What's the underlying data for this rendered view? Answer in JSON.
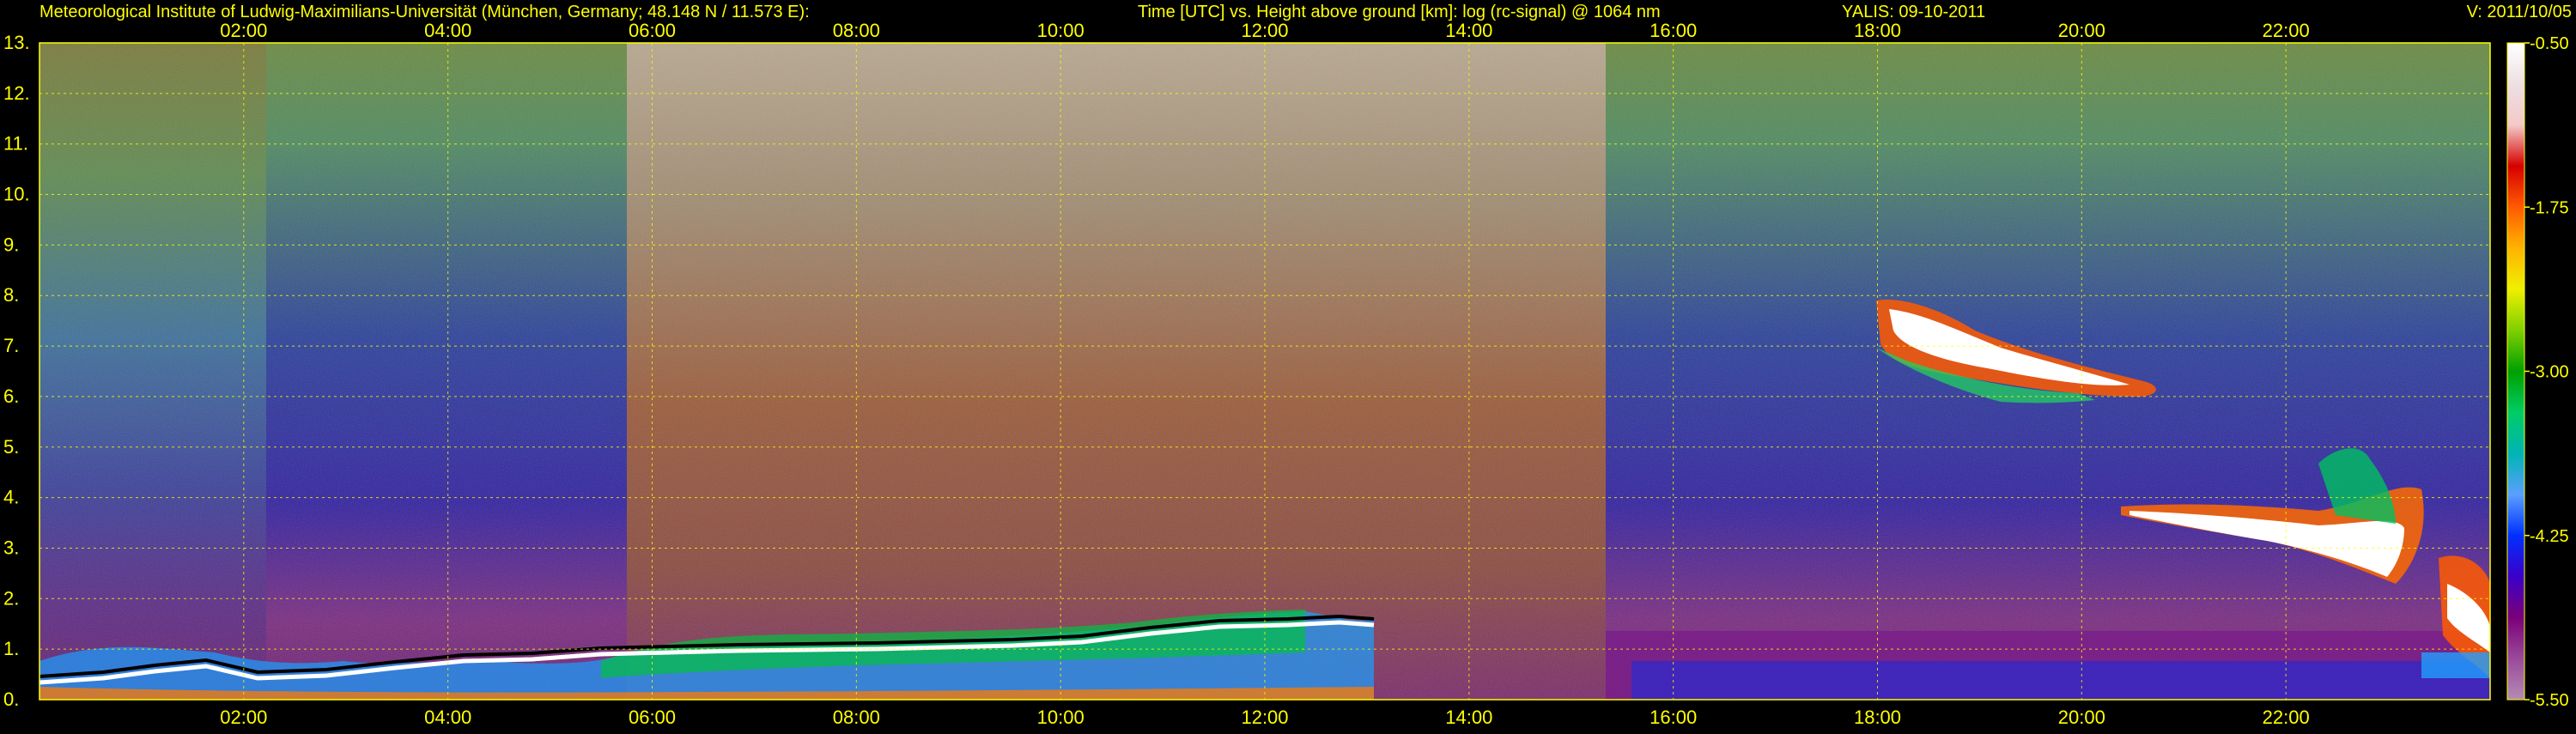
{
  "header": {
    "institute": "Meteorological Institute of Ludwig-Maximilians-Universität (München, Germany; 48.148 N / 11.573 E):",
    "plot_title": "Time [UTC] vs. Height above ground [km]: log (rc-signal) @ 1064 nm",
    "station_date": "YALIS: 09-10-2011",
    "version": "V: 2011/10/05"
  },
  "colors": {
    "background": "#000000",
    "text": "#FFFF00",
    "grid": "#FFFF00",
    "colormap": [
      "#FFFFFF",
      "#EDE0E3",
      "#F4C9C9",
      "#D60000",
      "#FF5A00",
      "#FFB300",
      "#EFEF00",
      "#7FD000",
      "#00A000",
      "#00CC66",
      "#00B4B4",
      "#5AA0FF",
      "#0030FF",
      "#3A00C8",
      "#7A007A",
      "#9A4A9A",
      "#B48CB4"
    ]
  },
  "chart_data": {
    "type": "heatmap",
    "title": "Time [UTC] vs. Height above ground [km]: log (rc-signal) @ 1064 nm",
    "xlabel": "Time [UTC]",
    "ylabel": "Height above ground [km]",
    "x_ticks": [
      "02:00",
      "04:00",
      "06:00",
      "08:00",
      "10:00",
      "12:00",
      "14:00",
      "16:00",
      "18:00",
      "20:00",
      "22:00"
    ],
    "x_tick_hours": [
      2,
      4,
      6,
      8,
      10,
      12,
      14,
      16,
      18,
      20,
      22
    ],
    "xlim_hours": [
      0,
      24
    ],
    "y_ticks": [
      "0.",
      "1.",
      "2.",
      "3.",
      "4.",
      "5.",
      "6.",
      "7.",
      "8.",
      "9.",
      "10.",
      "11.",
      "12.",
      "13."
    ],
    "y_tick_values": [
      0,
      1,
      2,
      3,
      4,
      5,
      6,
      7,
      8,
      9,
      10,
      11,
      12,
      13
    ],
    "ylim_km": [
      0,
      13
    ],
    "colorbar": {
      "ticks": [
        "-0.50",
        "-1.75",
        "-3.00",
        "-4.25",
        "-5.50"
      ],
      "tick_values": [
        -0.5,
        -1.75,
        -3.0,
        -4.25,
        -5.5
      ],
      "range": [
        -5.5,
        -0.5
      ]
    },
    "grid": true,
    "features": [
      {
        "name": "boundary layer top",
        "x_hours": [
          0.2,
          2,
          3,
          4,
          5,
          6,
          7,
          8,
          9,
          10,
          11,
          12,
          13
        ],
        "height_km": [
          0.3,
          0.5,
          0.3,
          0.55,
          0.7,
          0.75,
          0.85,
          0.75,
          0.8,
          0.95,
          1.1,
          1.35,
          1.3
        ]
      },
      {
        "name": "cirrus layer",
        "x_hours": [
          18.0,
          20.6
        ],
        "height_km": [
          7.8,
          6.1
        ]
      },
      {
        "name": "mid-level cloud",
        "x_hours": [
          20.4,
          22.9
        ],
        "height_km": [
          3.8,
          2.5
        ]
      }
    ]
  }
}
